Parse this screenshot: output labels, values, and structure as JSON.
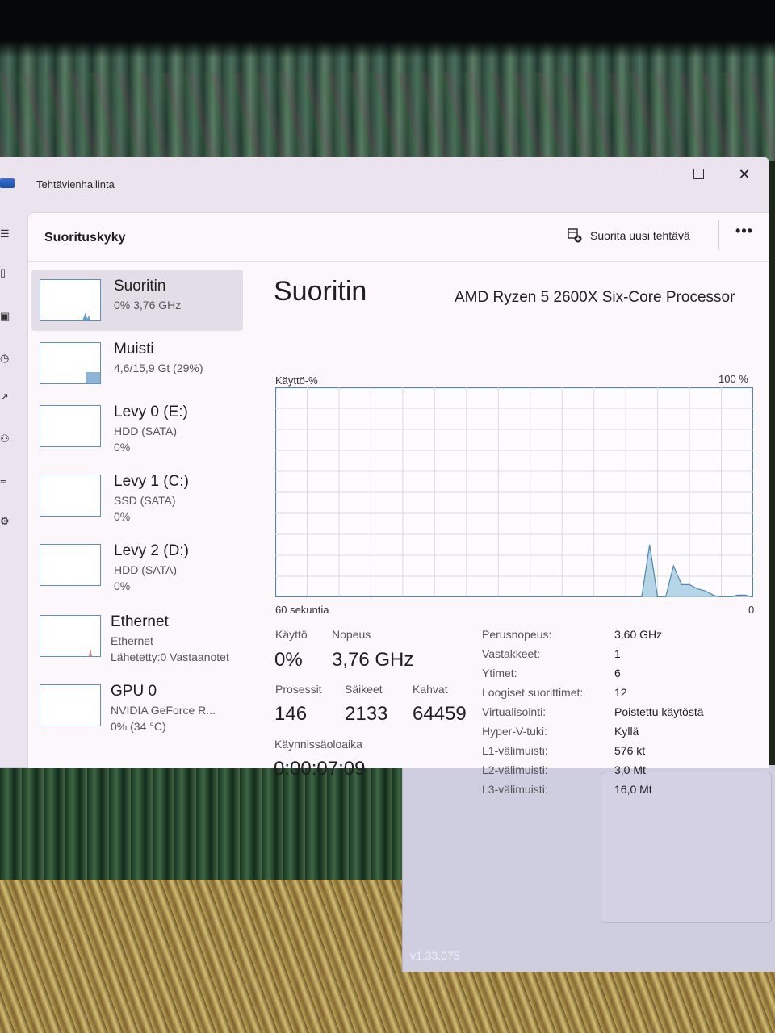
{
  "window": {
    "title": "Tehtävienhallinta"
  },
  "header": {
    "page_title": "Suorituskyky",
    "run_task_label": "Suorita uusi tehtävä",
    "more_label": "•••"
  },
  "sidebar": {
    "items": [
      {
        "name": "Suoritin",
        "line1": "0% 3,76 GHz",
        "line2": ""
      },
      {
        "name": "Muisti",
        "line1": "4,6/15,9 Gt (29%)",
        "line2": ""
      },
      {
        "name": "Levy 0 (E:)",
        "line1": "HDD (SATA)",
        "line2": "0%"
      },
      {
        "name": "Levy 1 (C:)",
        "line1": "SSD (SATA)",
        "line2": "0%"
      },
      {
        "name": "Levy 2 (D:)",
        "line1": "HDD (SATA)",
        "line2": "0%"
      },
      {
        "name": "Ethernet",
        "line1": "Ethernet",
        "line2": "Lähetetty:0 Vastaanotet"
      },
      {
        "name": "GPU 0",
        "line1": "NVIDIA GeForce R...",
        "line2": "0% (34 °C)"
      }
    ]
  },
  "detail": {
    "title": "Suoritin",
    "model": "AMD Ryzen 5 2600X Six-Core Processor",
    "graph_ylabel": "Käyttö-%",
    "graph_ymax_label": "100 %",
    "graph_xlabel": "60 sekuntia",
    "graph_xmin_label": "0",
    "stats": {
      "usage_label": "Käyttö",
      "usage_value": "0%",
      "speed_label": "Nopeus",
      "speed_value": "3,76 GHz",
      "processes_label": "Prosessit",
      "processes_value": "146",
      "threads_label": "Säikeet",
      "threads_value": "2133",
      "handles_label": "Kahvat",
      "handles_value": "64459",
      "uptime_label": "Käynnissäoloaika",
      "uptime_value": "0:00:07:09"
    },
    "specs": [
      {
        "label": "Perusnopeus:",
        "value": "3,60 GHz"
      },
      {
        "label": "Vastakkeet:",
        "value": "1"
      },
      {
        "label": "Ytimet:",
        "value": "6"
      },
      {
        "label": "Loogiset suorittimet:",
        "value": "12"
      },
      {
        "label": "Virtualisointi:",
        "value": "Poistettu käytöstä"
      },
      {
        "label": "Hyper-V-tuki:",
        "value": "Kyllä"
      },
      {
        "label": "L1-välimuisti:",
        "value": "576 kt"
      },
      {
        "label": "L2-välimuisti:",
        "value": "3,0 Mt"
      },
      {
        "label": "L3-välimuisti:",
        "value": "16,0 Mt"
      }
    ]
  },
  "cpu_usage_history": [
    0,
    0,
    0,
    0,
    0,
    0,
    0,
    0,
    0,
    0,
    0,
    0,
    0,
    0,
    0,
    0,
    0,
    0,
    0,
    0,
    0,
    0,
    0,
    0,
    0,
    0,
    0,
    0,
    0,
    0,
    0,
    0,
    0,
    0,
    0,
    0,
    0,
    0,
    0,
    0,
    0,
    0,
    0,
    0,
    0,
    0,
    0,
    25,
    0,
    0,
    15,
    6,
    6,
    4,
    3,
    1,
    0,
    0,
    1,
    1,
    0
  ],
  "version": "v1.33.075",
  "colors": {
    "accent": "#5f8fbf",
    "graph_fill": "#a9cfe3",
    "graph_line": "#4f87b0",
    "grid": "#d7dbe2"
  }
}
